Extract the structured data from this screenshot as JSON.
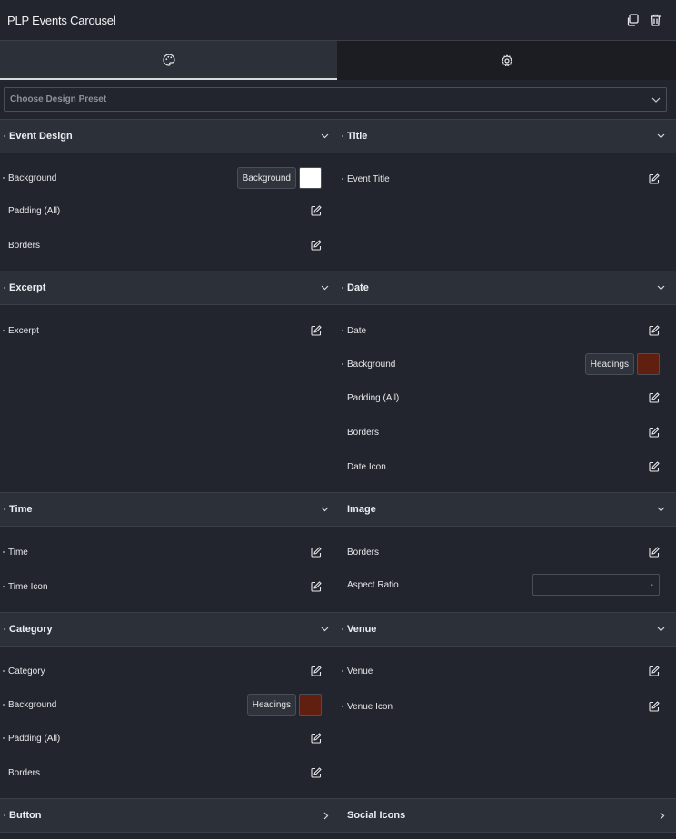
{
  "header": {
    "title": "PLP Events Carousel",
    "duplicate_icon": "duplicate-icon",
    "delete_icon": "trash-icon"
  },
  "tabs": [
    {
      "name": "style",
      "icon": "palette-icon",
      "active": true
    },
    {
      "name": "settings",
      "icon": "gear-icon",
      "active": false
    }
  ],
  "preset": {
    "placeholder": "Choose Design Preset"
  },
  "colors": {
    "white": "#ffffff",
    "brown": "#61200f",
    "panel": "#22252d",
    "bar": "#2c3039"
  },
  "sections": {
    "event_design": {
      "title": "Event Design",
      "rows": [
        "Background",
        "Padding (All)",
        "Borders"
      ],
      "bg_chip": "Background"
    },
    "title": {
      "title": "Title",
      "rows": [
        "Event Title"
      ]
    },
    "excerpt": {
      "title": "Excerpt",
      "rows": [
        "Excerpt"
      ]
    },
    "date": {
      "title": "Date",
      "rows": [
        "Date",
        "Background",
        "Padding (All)",
        "Borders",
        "Date Icon"
      ],
      "bg_chip": "Headings"
    },
    "time": {
      "title": "Time",
      "rows": [
        "Time",
        "Time Icon"
      ]
    },
    "image": {
      "title": "Image",
      "rows": [
        "Borders",
        "Aspect Ratio"
      ],
      "aspect_value": "-"
    },
    "category": {
      "title": "Category",
      "rows": [
        "Category",
        "Background",
        "Padding (All)",
        "Borders"
      ],
      "bg_chip": "Headings"
    },
    "venue": {
      "title": "Venue",
      "rows": [
        "Venue",
        "Venue Icon"
      ]
    },
    "button": {
      "title": "Button"
    },
    "social_icons": {
      "title": "Social Icons"
    }
  }
}
